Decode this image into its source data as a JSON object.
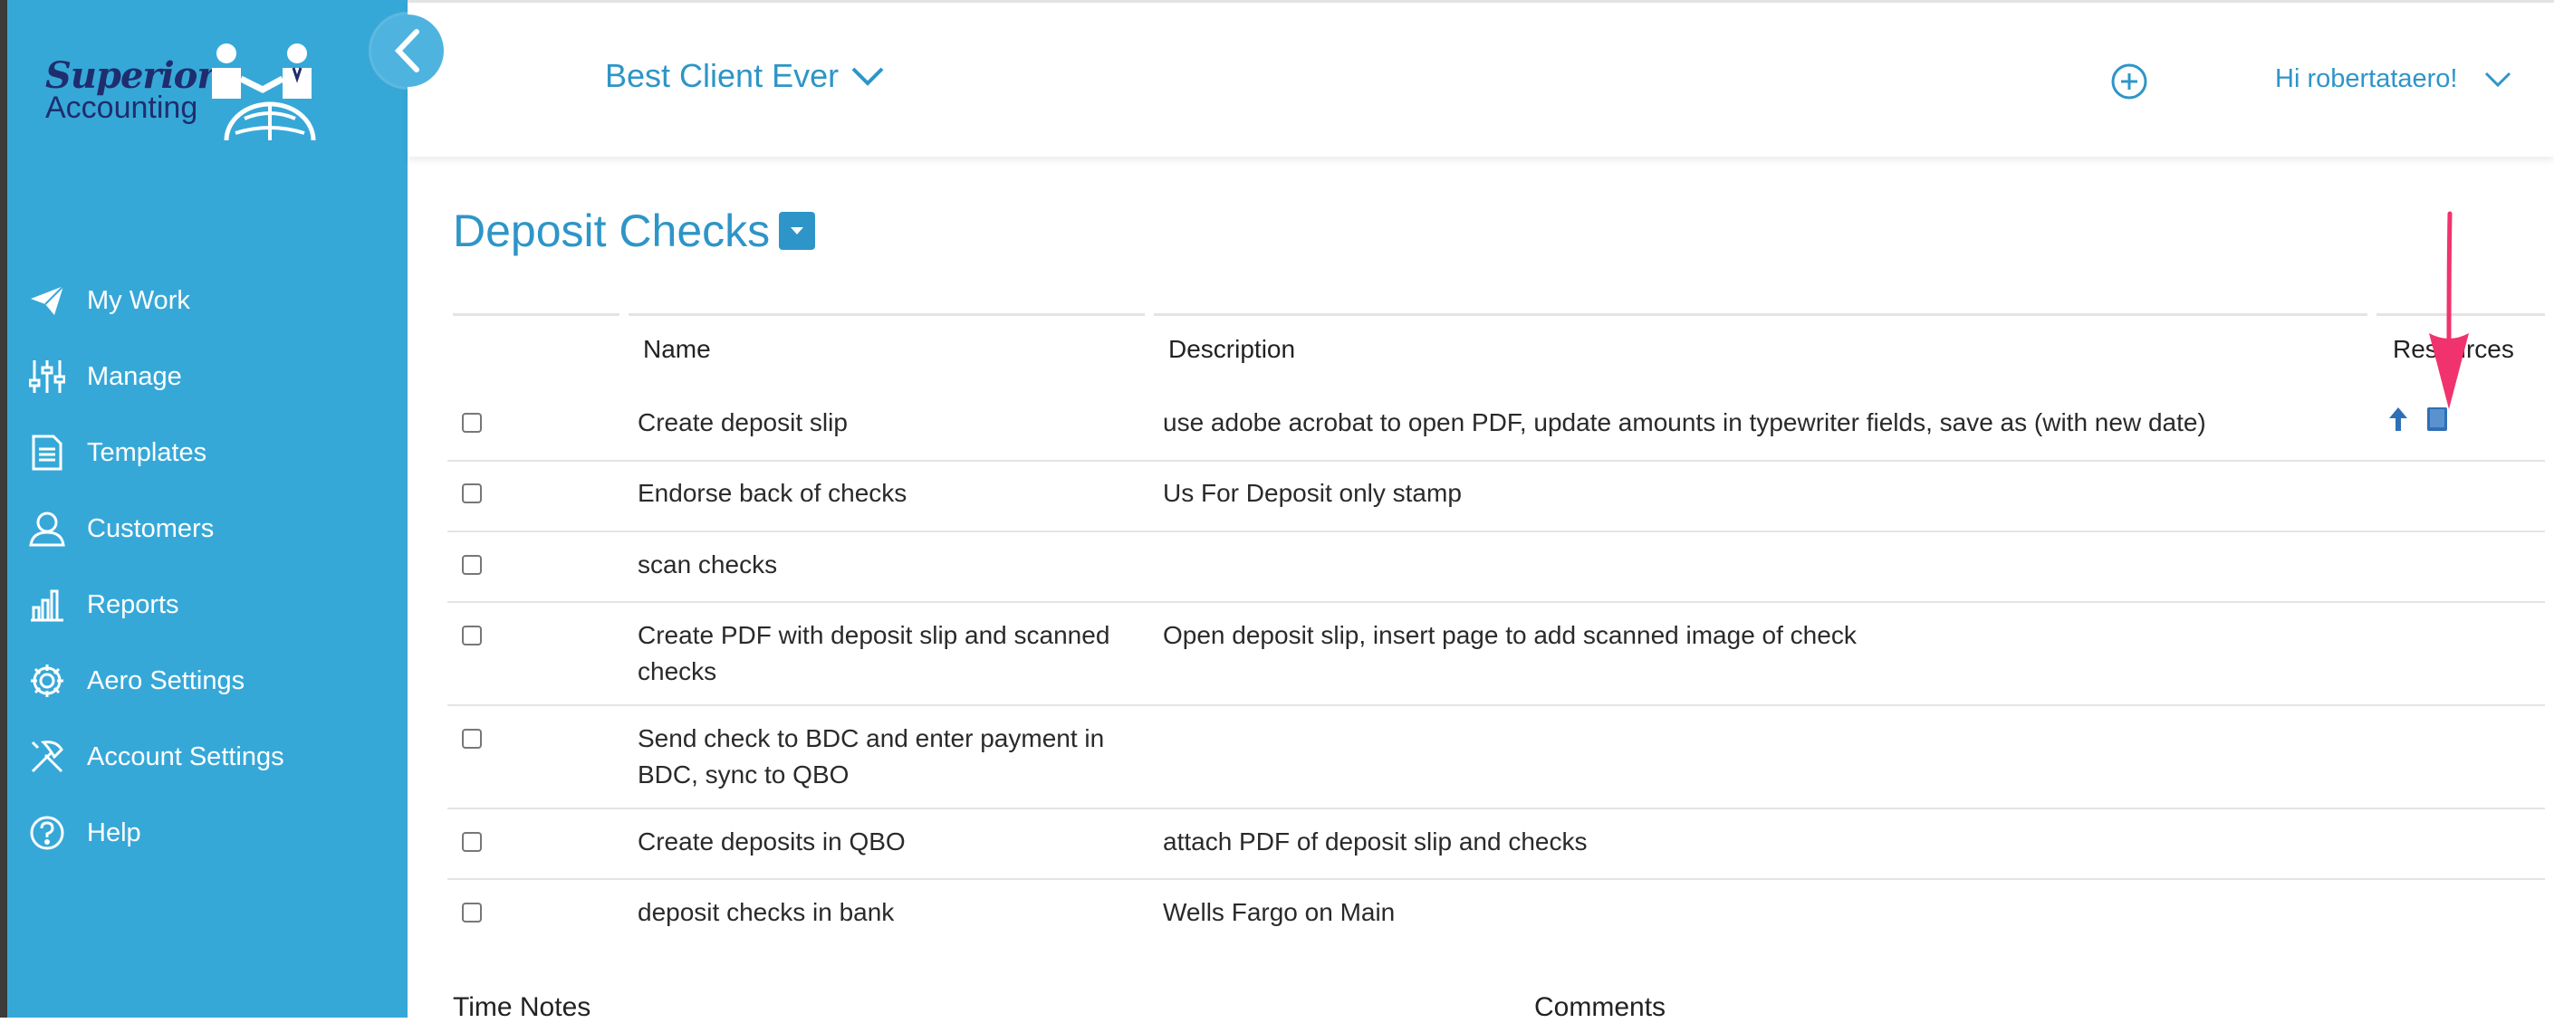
{
  "brand": {
    "line1": "Superior",
    "line2": "Accounting"
  },
  "sidebar": {
    "items": [
      {
        "label": "My Work",
        "icon": "paper-plane-icon"
      },
      {
        "label": "Manage",
        "icon": "sliders-icon"
      },
      {
        "label": "Templates",
        "icon": "document-icon"
      },
      {
        "label": "Customers",
        "icon": "user-icon"
      },
      {
        "label": "Reports",
        "icon": "bar-chart-icon"
      },
      {
        "label": "Aero Settings",
        "icon": "gear-icon"
      },
      {
        "label": "Account Settings",
        "icon": "tools-icon"
      },
      {
        "label": "Help",
        "icon": "question-circle-icon"
      }
    ]
  },
  "header": {
    "client": "Best Client Ever",
    "greeting": "Hi robertataero!"
  },
  "page": {
    "title": "Deposit Checks"
  },
  "table": {
    "columns": {
      "name": "Name",
      "description": "Description",
      "resources": "Resources"
    },
    "rows": [
      {
        "name": "Create deposit slip",
        "description": "use adobe acrobat to open PDF, update amounts in typewriter fields, save as (with new date)"
      },
      {
        "name": "Endorse back of checks",
        "description": "Us For Deposit only stamp"
      },
      {
        "name": "scan checks",
        "description": ""
      },
      {
        "name": "Create PDF with deposit slip and scanned checks",
        "description": "Open deposit slip, insert page to add scanned image of check"
      },
      {
        "name": "Send check to BDC and enter payment in BDC, sync to QBO",
        "description": ""
      },
      {
        "name": "Create deposits in QBO",
        "description": "attach PDF of deposit slip and checks"
      },
      {
        "name": "deposit checks in bank",
        "description": "Wells Fargo on Main"
      }
    ]
  },
  "footer": {
    "time_notes": "Time Notes",
    "comments": "Comments"
  },
  "colors": {
    "sidebar": "#36a8d8",
    "accent": "#2e95c8",
    "annotation": "#f0336e"
  }
}
